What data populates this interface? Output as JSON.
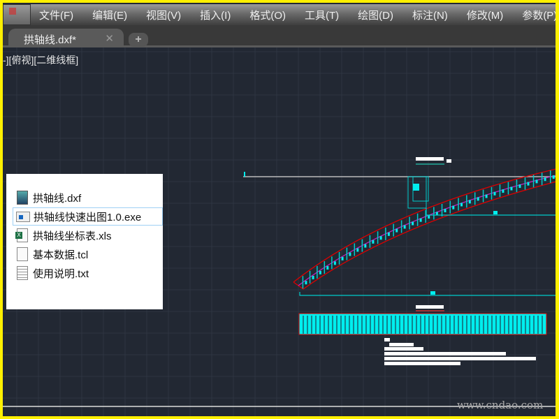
{
  "menu": [
    "文件(F)",
    "编辑(E)",
    "视图(V)",
    "插入(I)",
    "格式(O)",
    "工具(T)",
    "绘图(D)",
    "标注(N)",
    "修改(M)",
    "参数(P)"
  ],
  "tab": {
    "title": "拱轴线.dxf*",
    "close": "✕",
    "add": "+"
  },
  "viewport_label": "-][俯视][二维线框]",
  "files": [
    {
      "name": "拱轴线.dxf",
      "icon": "dxf-file-icon"
    },
    {
      "name": "拱轴线快速出图1.0.exe",
      "icon": "exe-file-icon"
    },
    {
      "name": "拱轴线坐标表.xls",
      "icon": "excel-file-icon"
    },
    {
      "name": "基本数据.tcl",
      "icon": "blank-file-icon"
    },
    {
      "name": "使用说明.txt",
      "icon": "text-file-icon"
    }
  ],
  "watermark": "www.cndao.com",
  "colors": {
    "canvas": "#222833",
    "arch_outline": "#d00000",
    "axis": "#c020c0",
    "entities": "#00e5e5",
    "frame": "#fff000"
  }
}
